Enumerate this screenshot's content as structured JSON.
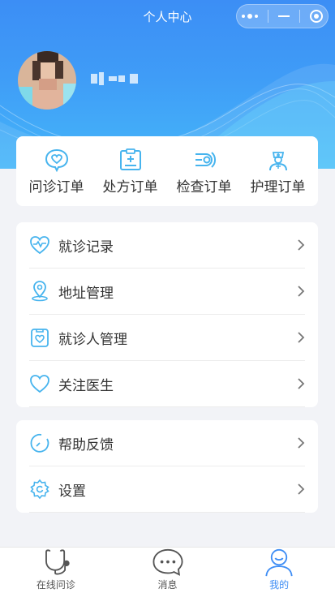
{
  "header": {
    "title": "个人中心"
  },
  "colors": {
    "primary": "#3f8ef5",
    "icon_accent": "#47b4ee",
    "text": "#333333"
  },
  "orders": [
    {
      "label": "问诊订单",
      "icon": "heart-chat-icon"
    },
    {
      "label": "处方订单",
      "icon": "prescription-icon"
    },
    {
      "label": "检查订单",
      "icon": "scan-icon"
    },
    {
      "label": "护理订单",
      "icon": "nurse-icon"
    }
  ],
  "menu_group1": [
    {
      "label": "就诊记录",
      "icon": "heartbeat-icon"
    },
    {
      "label": "地址管理",
      "icon": "location-icon"
    },
    {
      "label": "就诊人管理",
      "icon": "patient-icon"
    },
    {
      "label": "关注医生",
      "icon": "heart-icon"
    }
  ],
  "menu_group2": [
    {
      "label": "帮助反馈",
      "icon": "help-icon"
    },
    {
      "label": "设置",
      "icon": "settings-icon"
    }
  ],
  "tabs": [
    {
      "label": "在线问诊",
      "icon": "stethoscope-icon",
      "active": false
    },
    {
      "label": "消息",
      "icon": "message-icon",
      "active": false
    },
    {
      "label": "我的",
      "icon": "user-icon",
      "active": true
    }
  ]
}
